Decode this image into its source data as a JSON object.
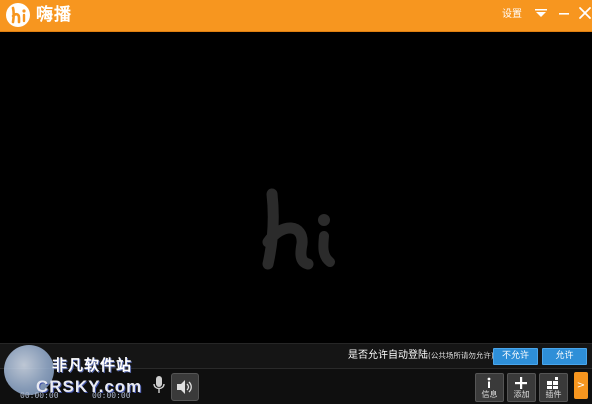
{
  "titlebar": {
    "app_name": "嗨播",
    "settings_label": "设置"
  },
  "login_prompt": {
    "question": "是否允许自动登陆",
    "note": "(公共场所请勿允许)",
    "deny_label": "不允许",
    "allow_label": "允许"
  },
  "toolbar": {
    "info_label": "信息",
    "add_label": "添加",
    "plugin_label": "插件",
    "expand_label": ">"
  },
  "site_watermark": {
    "name": "非凡软件站",
    "domain": "CRSKY.com",
    "left_count": "00:00:00",
    "right_count": "00:00:00"
  },
  "colors": {
    "accent": "#f7961f",
    "button_blue": "#2e8fd8",
    "background": "#000000"
  }
}
